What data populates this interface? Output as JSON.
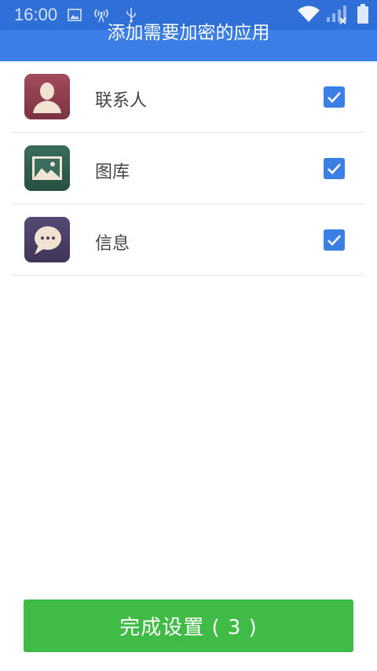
{
  "status_bar": {
    "time": "16:00",
    "icons": [
      "image-icon",
      "hotspot-icon",
      "usb-icon",
      "wifi-icon",
      "signal-no-service-icon",
      "battery-icon"
    ]
  },
  "header": {
    "title": "添加需要加密的应用",
    "color": "#3a7ee6"
  },
  "apps": [
    {
      "name": "联系人",
      "icon": "contacts-icon",
      "icon_color": "#8a3d4d",
      "checked": true
    },
    {
      "name": "图库",
      "icon": "gallery-icon",
      "icon_color": "#2f5f4f",
      "checked": true
    },
    {
      "name": "信息",
      "icon": "messages-icon",
      "icon_color": "#4a3f66",
      "checked": true
    }
  ],
  "footer": {
    "done_label": "完成设置 ( 3 )",
    "button_color": "#3fbb46"
  }
}
